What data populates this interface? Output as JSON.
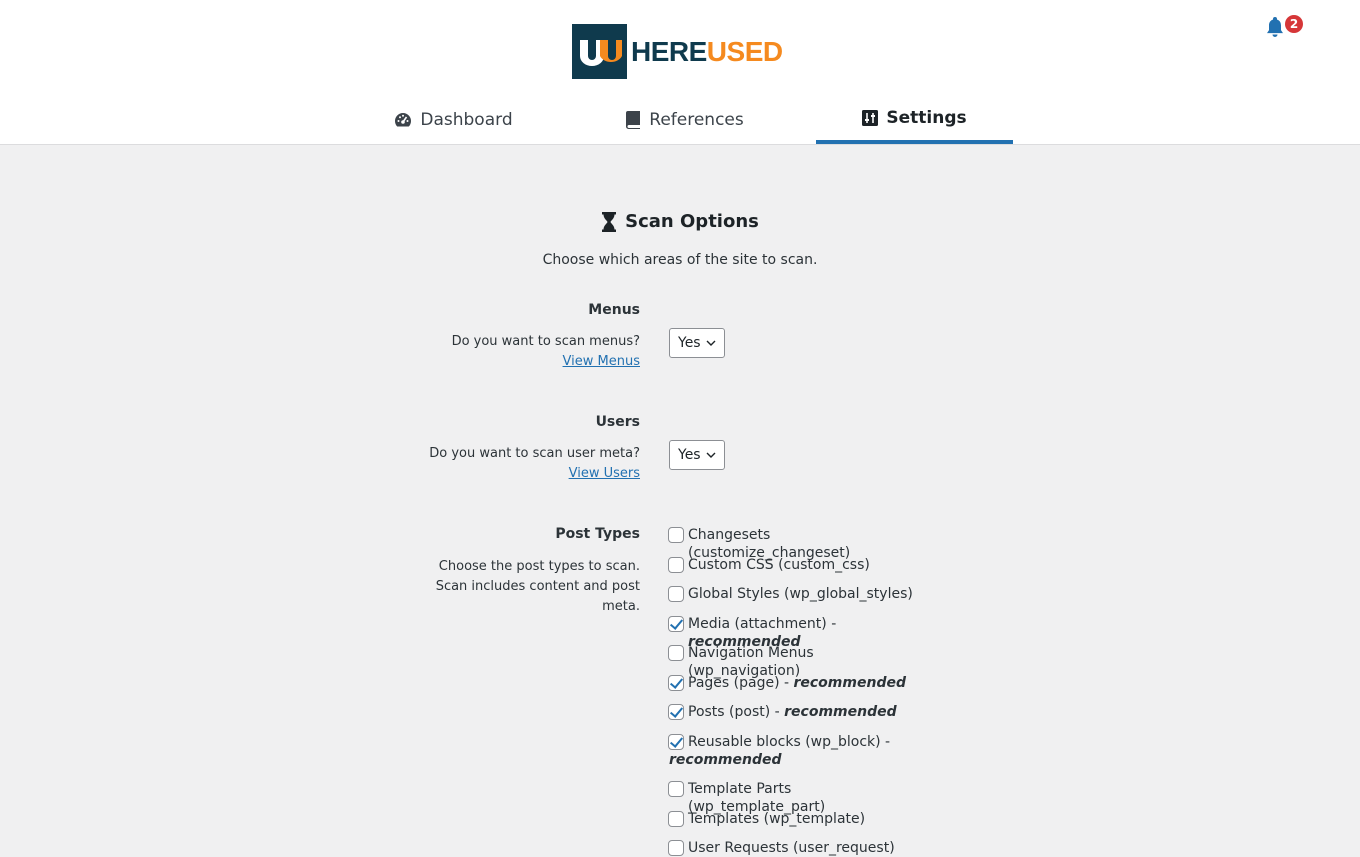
{
  "header": {
    "logo_parts": {
      "first": "HERE",
      "second": "U",
      "third": "SED"
    },
    "notifications_count": "2"
  },
  "tabs": [
    {
      "label": "Dashboard",
      "icon": "dashboard-gauge-icon"
    },
    {
      "label": "References",
      "icon": "book-icon"
    },
    {
      "label": "Settings",
      "icon": "sliders-icon"
    }
  ],
  "scan": {
    "title": "Scan Options",
    "description": "Choose which areas of the site to scan."
  },
  "menus": {
    "label": "Menus",
    "question": "Do you want to scan menus?",
    "link": "View Menus",
    "value": "Yes"
  },
  "users": {
    "label": "Users",
    "question": "Do you want to scan user meta?",
    "link": "View Users",
    "value": "Yes"
  },
  "post_types": {
    "label": "Post Types",
    "description": "Choose the post types to scan. Scan includes content and post meta.",
    "items": [
      {
        "label": "Changesets (customize_changeset)",
        "checked": false,
        "rec": ""
      },
      {
        "label": "Custom CSS (custom_css)",
        "checked": false,
        "rec": ""
      },
      {
        "label": "Global Styles (wp_global_styles)",
        "checked": false,
        "rec": ""
      },
      {
        "label": "Media (attachment) - ",
        "checked": true,
        "rec": "recommended"
      },
      {
        "label": "Navigation Menus (wp_navigation)",
        "checked": false,
        "rec": ""
      },
      {
        "label": "Pages (page) - ",
        "checked": true,
        "rec": "recommended"
      },
      {
        "label": "Posts (post) - ",
        "checked": true,
        "rec": "recommended"
      },
      {
        "label": "Reusable blocks (wp_block) - ",
        "checked": true,
        "rec": "recommended"
      },
      {
        "label": "Template Parts (wp_template_part)",
        "checked": false,
        "rec": ""
      },
      {
        "label": "Templates (wp_template)",
        "checked": false,
        "rec": ""
      },
      {
        "label": "User Requests (user_request)",
        "checked": false,
        "rec": ""
      }
    ]
  },
  "colors": {
    "accent": "#2271b1",
    "logo_dark": "#0f3a4d",
    "logo_orange": "#f58a1f",
    "badge": "#d63638"
  }
}
